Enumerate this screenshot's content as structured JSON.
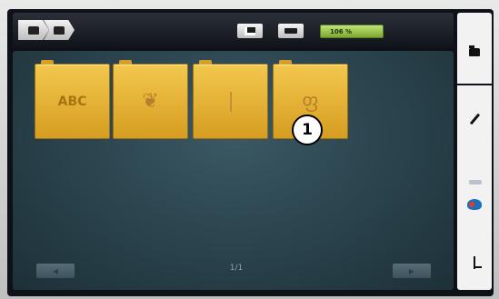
{
  "breadcrumb": {
    "items": [
      {
        "icon": "folder-icon"
      },
      {
        "icon": "folder-icon"
      }
    ]
  },
  "toolbar": {
    "mode_buttons": [
      {
        "icon": "embroidery-frame-icon"
      },
      {
        "icon": "hoop-icon"
      }
    ],
    "progress_text": "106 %"
  },
  "folders": [
    {
      "label": "ABC",
      "icon": "alphabet-icon"
    },
    {
      "label": "",
      "icon": "butterfly-icon",
      "glyph": "❦"
    },
    {
      "label": "",
      "icon": "stitch-line-icon"
    },
    {
      "label": "",
      "icon": "motif-icon",
      "glyph": "ფ"
    }
  ],
  "callout": {
    "number": "1"
  },
  "pagination": {
    "indicator": "1/1"
  },
  "sidebar": {
    "items": [
      {
        "icon": "folder-icon"
      },
      {
        "icon": "edit-pen-icon"
      },
      {
        "icon": "color-palette-icon"
      },
      {
        "icon": "stitch-icon"
      }
    ]
  },
  "colors": {
    "folder": "#e8b73a",
    "panel": "#2c4650",
    "progress": "#9cc543"
  }
}
